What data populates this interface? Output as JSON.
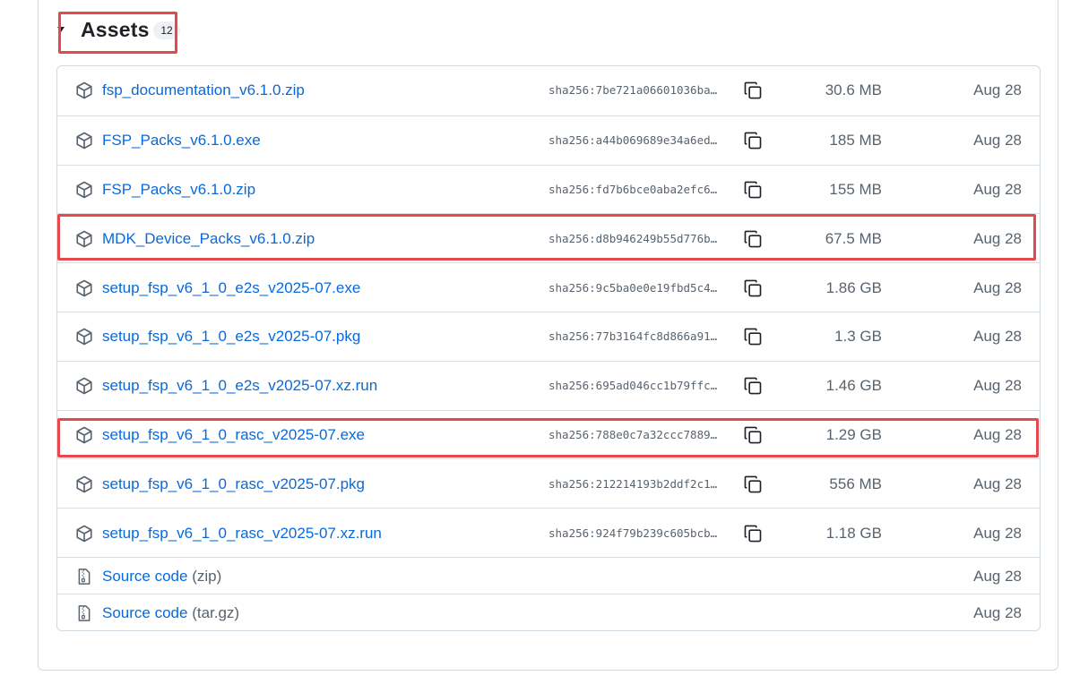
{
  "assets": {
    "title": "Assets",
    "count": "12",
    "items": [
      {
        "name": "fsp_documentation_v6.1.0.zip",
        "sha": "sha256:7be721a06601036ba…",
        "size": "30.6 MB",
        "date": "Aug 28"
      },
      {
        "name": "FSP_Packs_v6.1.0.exe",
        "sha": "sha256:a44b069689e34a6ed…",
        "size": "185 MB",
        "date": "Aug 28"
      },
      {
        "name": "FSP_Packs_v6.1.0.zip",
        "sha": "sha256:fd7b6bce0aba2efc6…",
        "size": "155 MB",
        "date": "Aug 28"
      },
      {
        "name": "MDK_Device_Packs_v6.1.0.zip",
        "sha": "sha256:d8b946249b55d776b…",
        "size": "67.5 MB",
        "date": "Aug 28"
      },
      {
        "name": "setup_fsp_v6_1_0_e2s_v2025-07.exe",
        "sha": "sha256:9c5ba0e0e19fbd5c4…",
        "size": "1.86 GB",
        "date": "Aug 28"
      },
      {
        "name": "setup_fsp_v6_1_0_e2s_v2025-07.pkg",
        "sha": "sha256:77b3164fc8d866a91…",
        "size": "1.3 GB",
        "date": "Aug 28"
      },
      {
        "name": "setup_fsp_v6_1_0_e2s_v2025-07.xz.run",
        "sha": "sha256:695ad046cc1b79ffc…",
        "size": "1.46 GB",
        "date": "Aug 28"
      },
      {
        "name": "setup_fsp_v6_1_0_rasc_v2025-07.exe",
        "sha": "sha256:788e0c7a32ccc7889…",
        "size": "1.29 GB",
        "date": "Aug 28"
      },
      {
        "name": "setup_fsp_v6_1_0_rasc_v2025-07.pkg",
        "sha": "sha256:212214193b2ddf2c1…",
        "size": "556 MB",
        "date": "Aug 28"
      },
      {
        "name": "setup_fsp_v6_1_0_rasc_v2025-07.xz.run",
        "sha": "sha256:924f79b239c605bcb…",
        "size": "1.18 GB",
        "date": "Aug 28"
      }
    ],
    "source_code": [
      {
        "label": "Source code",
        "suffix": "(zip)",
        "date": "Aug 28"
      },
      {
        "label": "Source code",
        "suffix": "(tar.gz)",
        "date": "Aug 28"
      }
    ]
  },
  "colors": {
    "link": "#0969da",
    "muted": "#59636e",
    "highlight": "#e5484d",
    "border": "#d1d9e0"
  },
  "icons": {
    "asset": "package-icon",
    "copy": "copy-icon",
    "source": "file-zip-icon",
    "toggle": "triangle-down-icon"
  }
}
